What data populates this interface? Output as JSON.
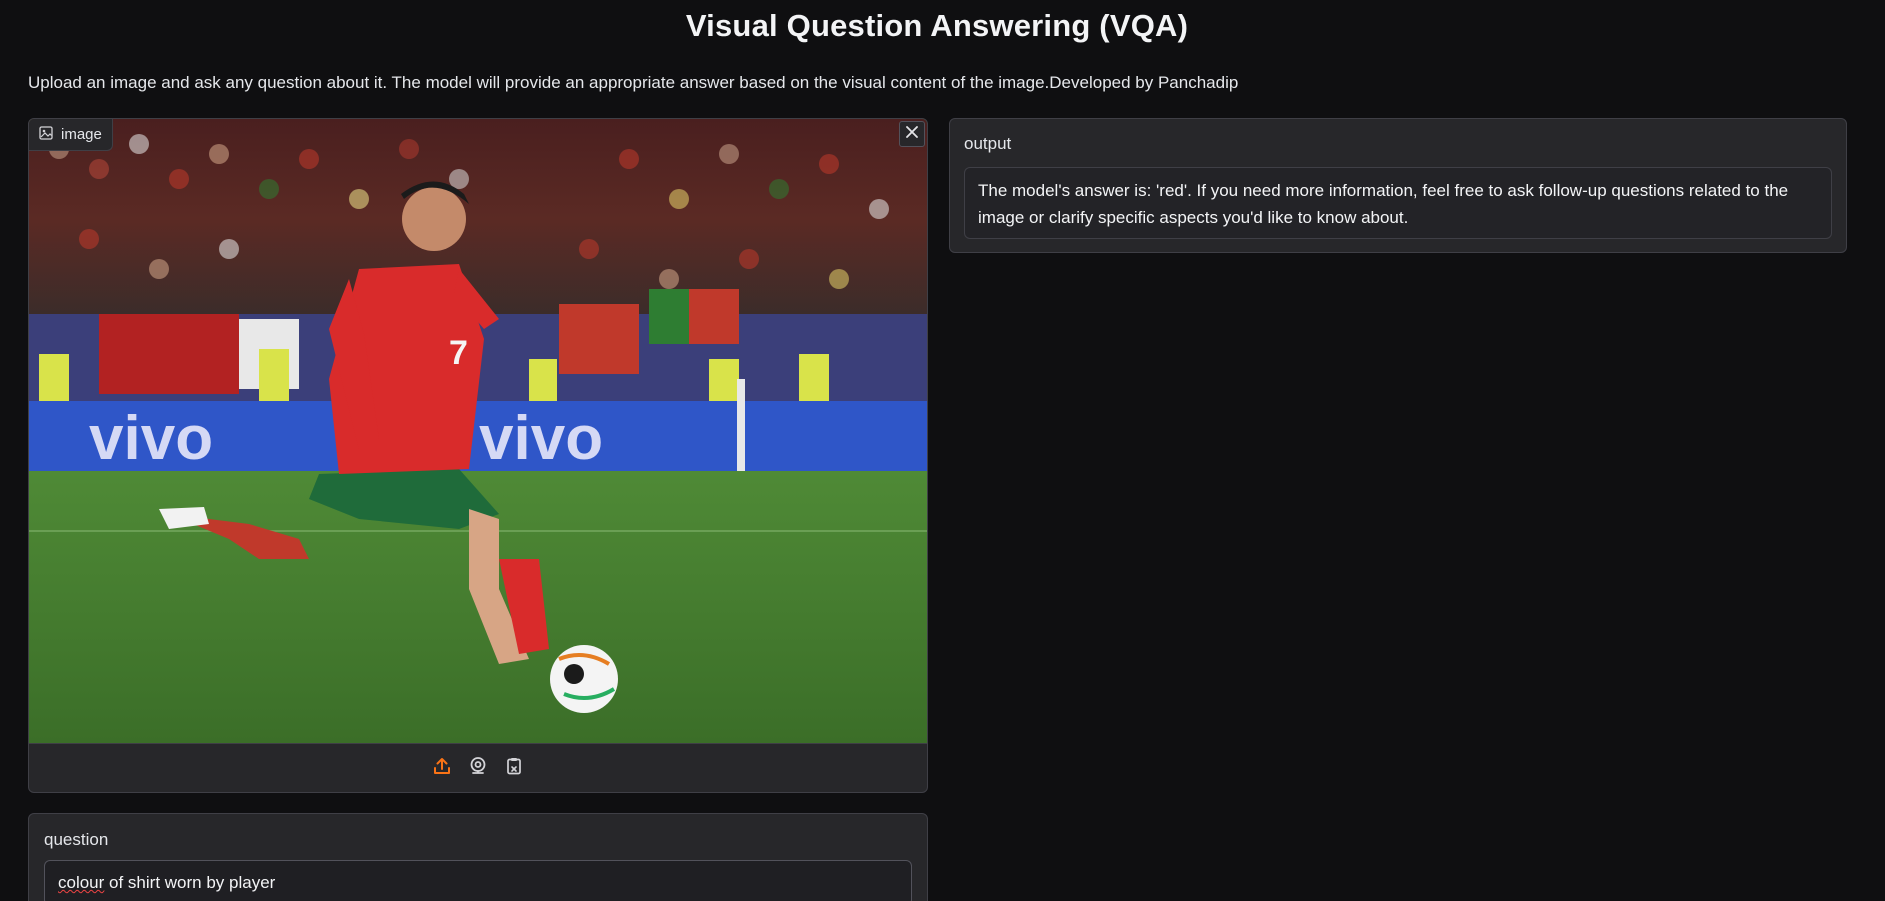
{
  "page": {
    "title": "Visual Question Answering (VQA)",
    "description": "Upload an image and ask any question about it. The model will provide an appropriate answer based on the visual content of the image.Developed by Panchadip"
  },
  "image_input": {
    "label": "image",
    "label_icon": "image-icon",
    "close_icon": "close-icon",
    "toolbar": [
      "upload-icon",
      "webcam-icon",
      "clipboard-icon"
    ],
    "accent_color": "#f97316"
  },
  "question": {
    "label": "question",
    "value_word1": "colour",
    "value_rest": " of shirt worn by player"
  },
  "output": {
    "label": "output",
    "text": "The model's answer is: 'red'. If you need more information, feel free to ask follow-up questions related to the image or clarify specific aspects you'd like to know about."
  },
  "colors": {
    "background": "#0f0f11",
    "panel": "#27272a",
    "border": "#3f3f46"
  }
}
